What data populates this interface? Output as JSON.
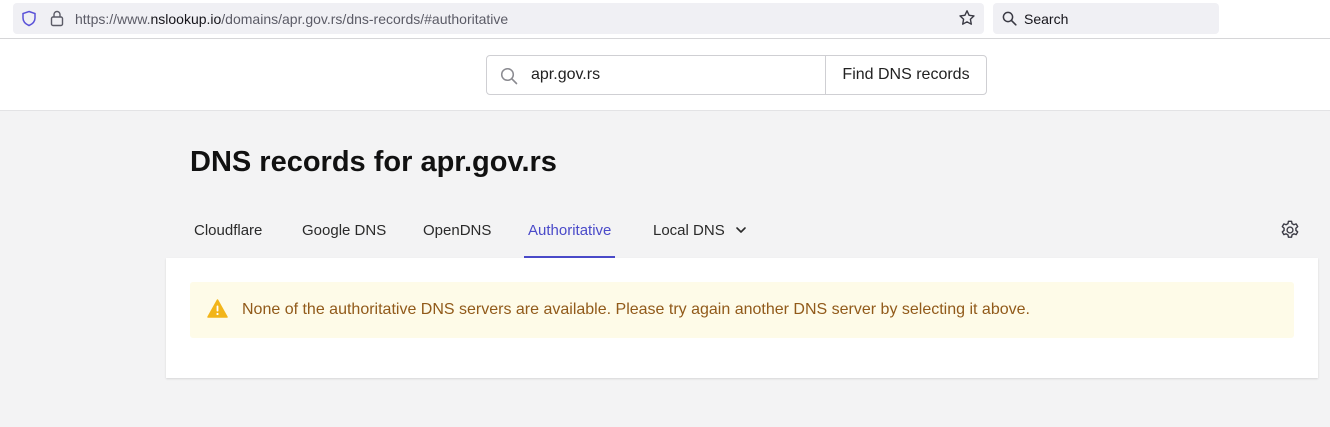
{
  "browser": {
    "url_prefix": "https://www.",
    "url_host": "nslookup.io",
    "url_path": "/domains/apr.gov.rs/dns-records/#authoritative",
    "search_label": "Search"
  },
  "search": {
    "value": "apr.gov.rs",
    "button_label": "Find DNS records"
  },
  "title": {
    "prefix": "DNS records for ",
    "domain": "apr.gov.rs"
  },
  "tabs": [
    {
      "label": "Cloudflare"
    },
    {
      "label": "Google DNS"
    },
    {
      "label": "OpenDNS"
    },
    {
      "label": "Authoritative",
      "active": true
    },
    {
      "label": "Local DNS",
      "dropdown": true
    }
  ],
  "alert": {
    "message": "None of the authoritative DNS servers are available. Please try again another DNS server by selecting it above."
  },
  "colors": {
    "accent": "#4a4ac9",
    "warning_text": "#915a1a",
    "warning_bg": "#fefbe8",
    "warning_icon": "#f2b51a"
  },
  "icons": [
    "shield-icon",
    "lock-icon",
    "star-icon",
    "search-icon",
    "chevron-down-icon",
    "gear-icon",
    "warning-icon"
  ]
}
